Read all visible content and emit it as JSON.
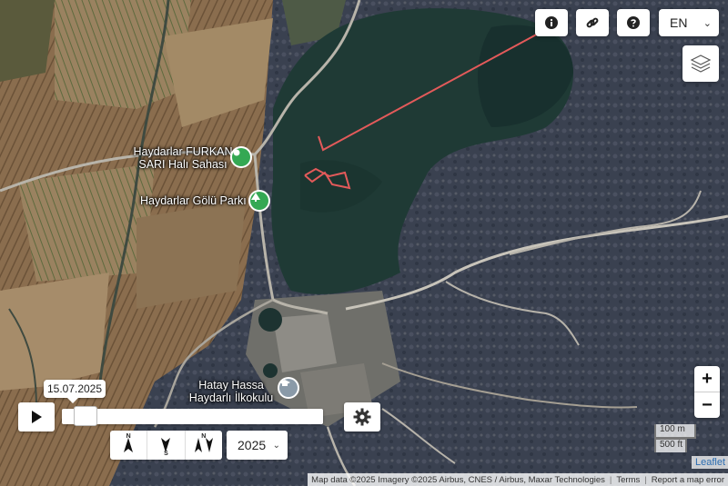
{
  "top_controls": {
    "language": "EN"
  },
  "icons": {
    "info": "info-circle-icon",
    "link": "link-icon",
    "help": "question-circle-icon",
    "layers": "layers-icon",
    "play": "play-icon",
    "settings": "gear-icon",
    "chevron": "chevron-down-icon"
  },
  "map": {
    "places": [
      {
        "name": "Haydarlar FURKAN SARI Halı Sahası",
        "line1": "Haydarlar FURKAN",
        "line2": "SARI Halı Sahası",
        "kind": "sports-pin",
        "color": "#34a853"
      },
      {
        "name": "Haydarlar Gölü Parkı",
        "kind": "park-pin",
        "color": "#34a853"
      },
      {
        "name": "Hatay Hassa Haydarlı İlkokulu",
        "line1": "Hatay Hassa",
        "line2": "Haydarlı İlkokulu",
        "kind": "school-pin",
        "color": "#8a9aa8"
      }
    ],
    "track_color": "#e35a5a"
  },
  "timeline": {
    "date": "15.07.2025",
    "slider_position": 0.05,
    "year": "2025",
    "compass": {
      "n": "N",
      "s": "S",
      "n2": "N"
    }
  },
  "zoom": {
    "in_label": "+",
    "out_label": "−"
  },
  "scale": {
    "metric": "100 m",
    "imperial": "500 ft"
  },
  "attribution": {
    "leaflet": "Leaflet",
    "map_data": "Map data ©2025 Imagery ©2025 Airbus, CNES / Airbus, Maxar Technologies",
    "terms": "Terms",
    "report": "Report a map error"
  }
}
